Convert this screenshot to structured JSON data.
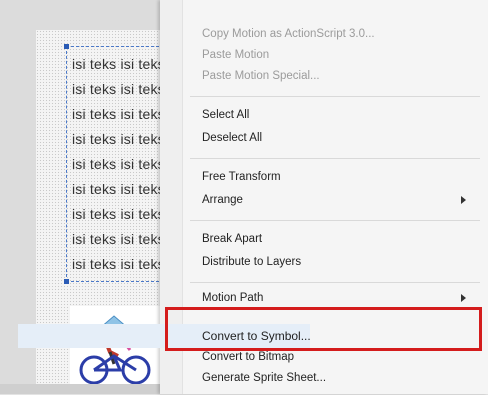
{
  "stage": {
    "text_lines": [
      "isi teks isi teks",
      "isi teks isi teks",
      "isi teks isi teks",
      "isi teks isi teks",
      "isi teks isi teks",
      "isi teks isi teks",
      "isi teks isi teks",
      "isi teks isi teks",
      "isi teks isi teks"
    ]
  },
  "menu": {
    "copy_motion_as3": "Copy Motion as ActionScript 3.0...",
    "paste_motion": "Paste Motion",
    "paste_motion_special": "Paste Motion Special...",
    "select_all": "Select All",
    "deselect_all": "Deselect All",
    "free_transform": "Free Transform",
    "arrange": "Arrange",
    "break_apart": "Break Apart",
    "distribute_to_layers": "Distribute to Layers",
    "motion_path": "Motion Path",
    "convert_to_symbol": "Convert to Symbol...",
    "convert_to_bitmap": "Convert to Bitmap",
    "generate_sprite_sheet": "Generate Sprite Sheet..."
  },
  "colors": {
    "highlight_border": "#d41c1c",
    "selection_frame": "#4a78c8"
  }
}
